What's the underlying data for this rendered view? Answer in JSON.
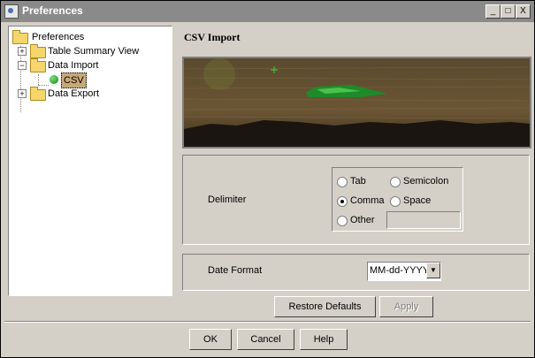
{
  "window": {
    "title": "Preferences",
    "controls": {
      "minimize": "_",
      "maximize": "□",
      "close": "X"
    }
  },
  "tree": {
    "items": [
      {
        "label": "Preferences",
        "expander": ""
      },
      {
        "label": "Table Summary View",
        "expander": "+"
      },
      {
        "label": "Data Import",
        "expander": "−"
      },
      {
        "label": "CSV",
        "expander": ""
      },
      {
        "label": "Data Export",
        "expander": "+"
      }
    ]
  },
  "panel": {
    "title": "CSV Import",
    "delimiter": {
      "label": "Delimiter",
      "options": {
        "tab": "Tab",
        "semicolon": "Semicolon",
        "comma": "Comma",
        "space": "Space",
        "other": "Other"
      },
      "selected": "Comma",
      "other_value": ""
    },
    "date_format": {
      "label": "Date Format",
      "value": "MM-dd-YYYY"
    },
    "buttons": {
      "restore": "Restore Defaults",
      "apply": "Apply"
    }
  },
  "footer": {
    "ok": "OK",
    "cancel": "Cancel",
    "help": "Help"
  },
  "colors": {
    "titlebar": "#8a8a8a",
    "face": "#d4d0c8",
    "selection": "#c7a87a"
  }
}
